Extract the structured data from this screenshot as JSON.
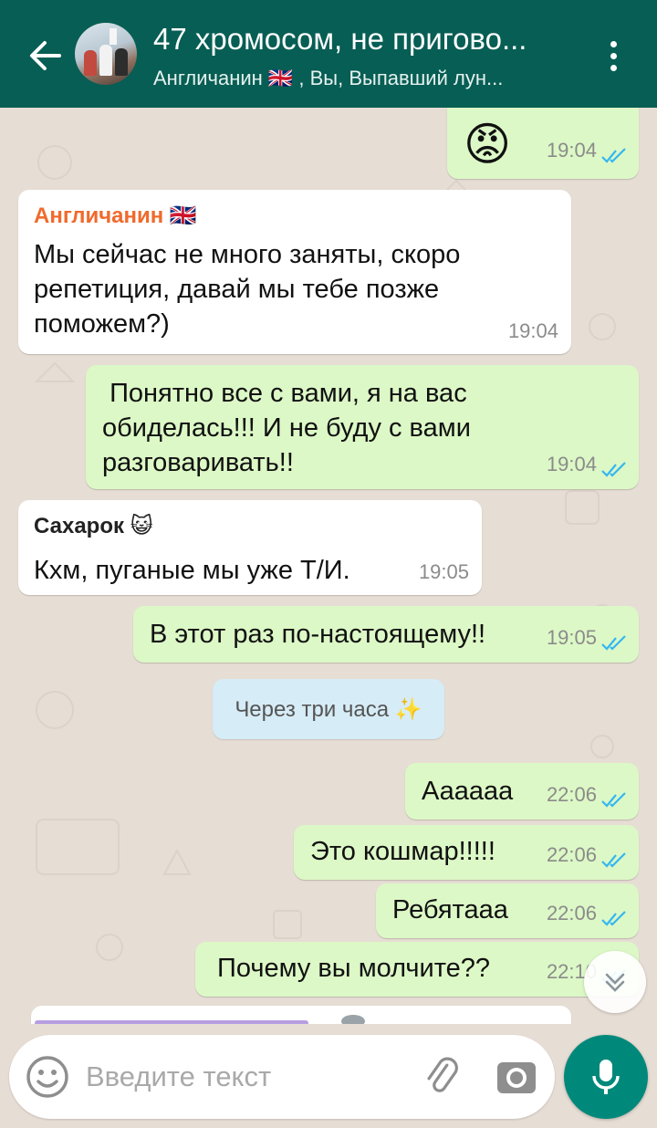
{
  "header": {
    "title": "47 хромосом, не пригово...",
    "subtitle": "Англичанин 🇬🇧 , Вы, Выпавший лун..."
  },
  "messages": [
    {
      "dir": "out",
      "emoji": "😡",
      "time": "19:04",
      "read": true
    },
    {
      "dir": "in",
      "sender": "Англичанин 🇬🇧",
      "sender_color": "#f06a2c",
      "text": "Мы сейчас не много заняты, скоро репетиция, давай мы тебе позже поможем?)",
      "time": "19:04"
    },
    {
      "dir": "out",
      "text": " Понятно все с вами, я на вас обиделась!!! И не буду с вами разговаривать!!",
      "time": "19:04",
      "read": true
    },
    {
      "dir": "in",
      "sender": "Сахарок 😺",
      "sender_color": "#222222",
      "text": "Кхм, пуганые мы уже Т/И.",
      "time": "19:05"
    },
    {
      "dir": "out",
      "text": "В этот раз по-настоящему!!",
      "time": "19:05",
      "read": true
    },
    {
      "dir": "system",
      "text": "Через три часа ✨"
    },
    {
      "dir": "out",
      "text": "Аааааа",
      "time": "22:06",
      "read": true
    },
    {
      "dir": "out",
      "text": "Это кошмар!!!!!",
      "time": "22:06",
      "read": true
    },
    {
      "dir": "out",
      "text": "Ребятааа",
      "time": "22:06",
      "read": true
    },
    {
      "dir": "out",
      "text": "Почему вы молчите??",
      "time": "22:10",
      "read": true
    }
  ],
  "input": {
    "placeholder": "Введите текст"
  },
  "colors": {
    "header": "#075e54",
    "outgoing": "#dcf8c6",
    "incoming": "#ffffff",
    "accent": "#00897b",
    "read_ticks": "#34b7f1",
    "partial_sender": "#7b4fc9"
  },
  "icons": {
    "back": "arrow-left-icon",
    "menu": "more-vert-icon",
    "emoji": "smiley-icon",
    "attach": "paperclip-icon",
    "camera": "camera-icon",
    "mic": "microphone-icon",
    "scroll": "chevron-double-down-icon"
  }
}
